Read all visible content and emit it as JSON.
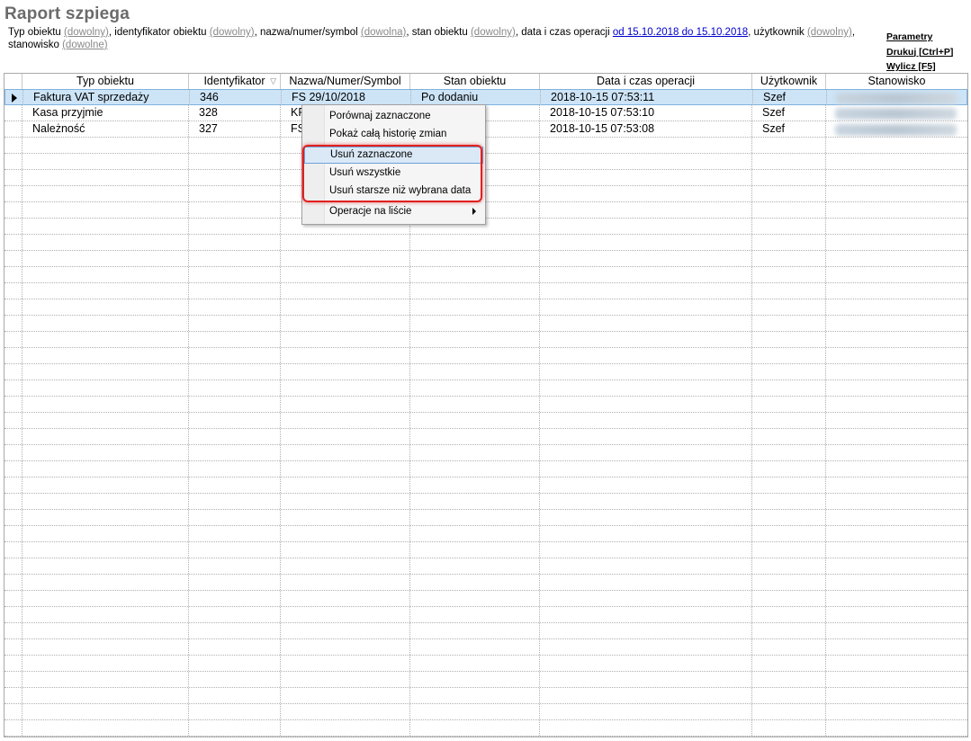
{
  "title": "Raport szpiega",
  "filters": {
    "f1_label": "Typ obiektu ",
    "f1_value": "(dowolny)",
    "f2_label": ", identyfikator obiektu ",
    "f2_value": "(dowolny)",
    "f3_label": ", nazwa/numer/symbol ",
    "f3_value": "(dowolna)",
    "f4_label": ", stan obiektu ",
    "f4_value": "(dowolny)",
    "f5_label": ", data i czas operacji ",
    "f5_value": "od 15.10.2018 do 15.10.2018",
    "f6_label": ", użytkownik ",
    "f6_value": "(dowolny)",
    "f7_label": ", stanowisko ",
    "f7_value": "(dowolne)"
  },
  "actions": {
    "params": "Parametry",
    "print": "Drukuj [Ctrl+P]",
    "compute": "Wylicz [F5]"
  },
  "columns": [
    "Typ obiektu",
    "Identyfikator",
    "Nazwa/Numer/Symbol",
    "Stan obiektu",
    "Data i czas operacji",
    "Użytkownik",
    "Stanowisko"
  ],
  "sort_indicator": "▽",
  "rows": [
    {
      "type": "Faktura VAT sprzedaży",
      "id": "346",
      "name": "FS 29/10/2018",
      "state": "Po dodaniu",
      "date": "2018-10-15 07:53:11",
      "user": "Szef"
    },
    {
      "type": "Kasa przyjmie",
      "id": "328",
      "name": "KP",
      "state": "",
      "date": "2018-10-15 07:53:10",
      "user": "Szef"
    },
    {
      "type": "Należność",
      "id": "327",
      "name": "FS",
      "state": "",
      "date": "2018-10-15 07:53:08",
      "user": "Szef"
    }
  ],
  "context_menu": {
    "compare": "Porównaj zaznaczone",
    "history": "Pokaż całą historię zmian",
    "delete_selected": "Usuń zaznaczone",
    "delete_all": "Usuń wszystkie",
    "delete_older": "Usuń starsze niż wybrana data",
    "list_ops": "Operacje na liście"
  }
}
